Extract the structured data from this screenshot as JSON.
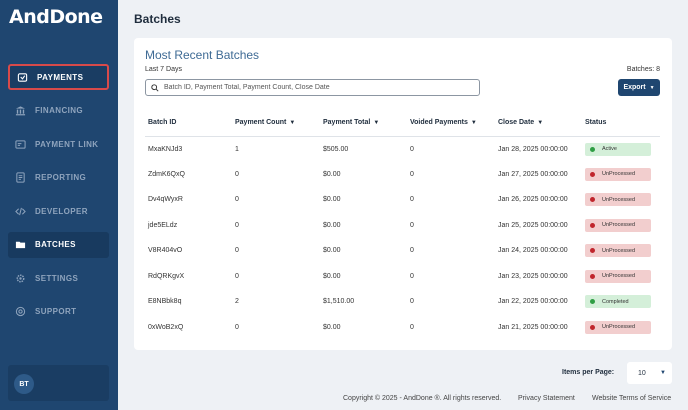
{
  "brand": {
    "name": "AndDone"
  },
  "sidebar": {
    "items": [
      {
        "label": "PAYMENTS",
        "icon": "payments-icon"
      },
      {
        "label": "FINANCING",
        "icon": "bank-icon"
      },
      {
        "label": "PAYMENT LINK",
        "icon": "link-icon"
      },
      {
        "label": "REPORTING",
        "icon": "report-icon"
      },
      {
        "label": "DEVELOPER",
        "icon": "code-icon"
      },
      {
        "label": "BATCHES",
        "icon": "batches-icon"
      },
      {
        "label": "SETTINGS",
        "icon": "gear-icon"
      },
      {
        "label": "SUPPORT",
        "icon": "support-icon"
      }
    ],
    "user_initials": "BT"
  },
  "page": {
    "title": "Batches"
  },
  "card": {
    "title": "Most Recent Batches",
    "subtitle": "Last 7 Days",
    "batch_count": "Batches: 8",
    "search_placeholder": "Batch ID, Payment Total, Payment Count, Close Date",
    "export_label": "Export"
  },
  "table": {
    "headers": [
      "Batch ID",
      "Payment Count",
      "Payment Total",
      "Voided Payments",
      "Close Date",
      "Status"
    ],
    "rows": [
      {
        "id": "MxaKNJd3",
        "count": "1",
        "total": "$505.00",
        "voided": "0",
        "date": "Jan 28, 2025 00:00:00",
        "status": "Active"
      },
      {
        "id": "ZdmK6QxQ",
        "count": "0",
        "total": "$0.00",
        "voided": "0",
        "date": "Jan 27, 2025 00:00:00",
        "status": "UnProcessed"
      },
      {
        "id": "Dv4qWyxR",
        "count": "0",
        "total": "$0.00",
        "voided": "0",
        "date": "Jan 26, 2025 00:00:00",
        "status": "UnProcessed"
      },
      {
        "id": "jde5ELdz",
        "count": "0",
        "total": "$0.00",
        "voided": "0",
        "date": "Jan 25, 2025 00:00:00",
        "status": "UnProcessed"
      },
      {
        "id": "V8R404vO",
        "count": "0",
        "total": "$0.00",
        "voided": "0",
        "date": "Jan 24, 2025 00:00:00",
        "status": "UnProcessed"
      },
      {
        "id": "RdQRKgvX",
        "count": "0",
        "total": "$0.00",
        "voided": "0",
        "date": "Jan 23, 2025 00:00:00",
        "status": "UnProcessed"
      },
      {
        "id": "E8NBbk8q",
        "count": "2",
        "total": "$1,510.00",
        "voided": "0",
        "date": "Jan 22, 2025 00:00:00",
        "status": "Completed"
      },
      {
        "id": "0xWoB2xQ",
        "count": "0",
        "total": "$0.00",
        "voided": "0",
        "date": "Jan 21, 2025 00:00:00",
        "status": "UnProcessed"
      }
    ]
  },
  "pagination": {
    "label": "Items per Page:",
    "value": "10"
  },
  "footer": {
    "copyright": "Copyright © 2025 - AndDone ®. All rights reserved.",
    "privacy": "Privacy Statement",
    "terms": "Website Terms of Service"
  },
  "colors": {
    "sidebar": "#1f4670",
    "accent_red": "#d84a4a",
    "status_ok": "#2f9e44",
    "status_bad": "#c0262d"
  }
}
